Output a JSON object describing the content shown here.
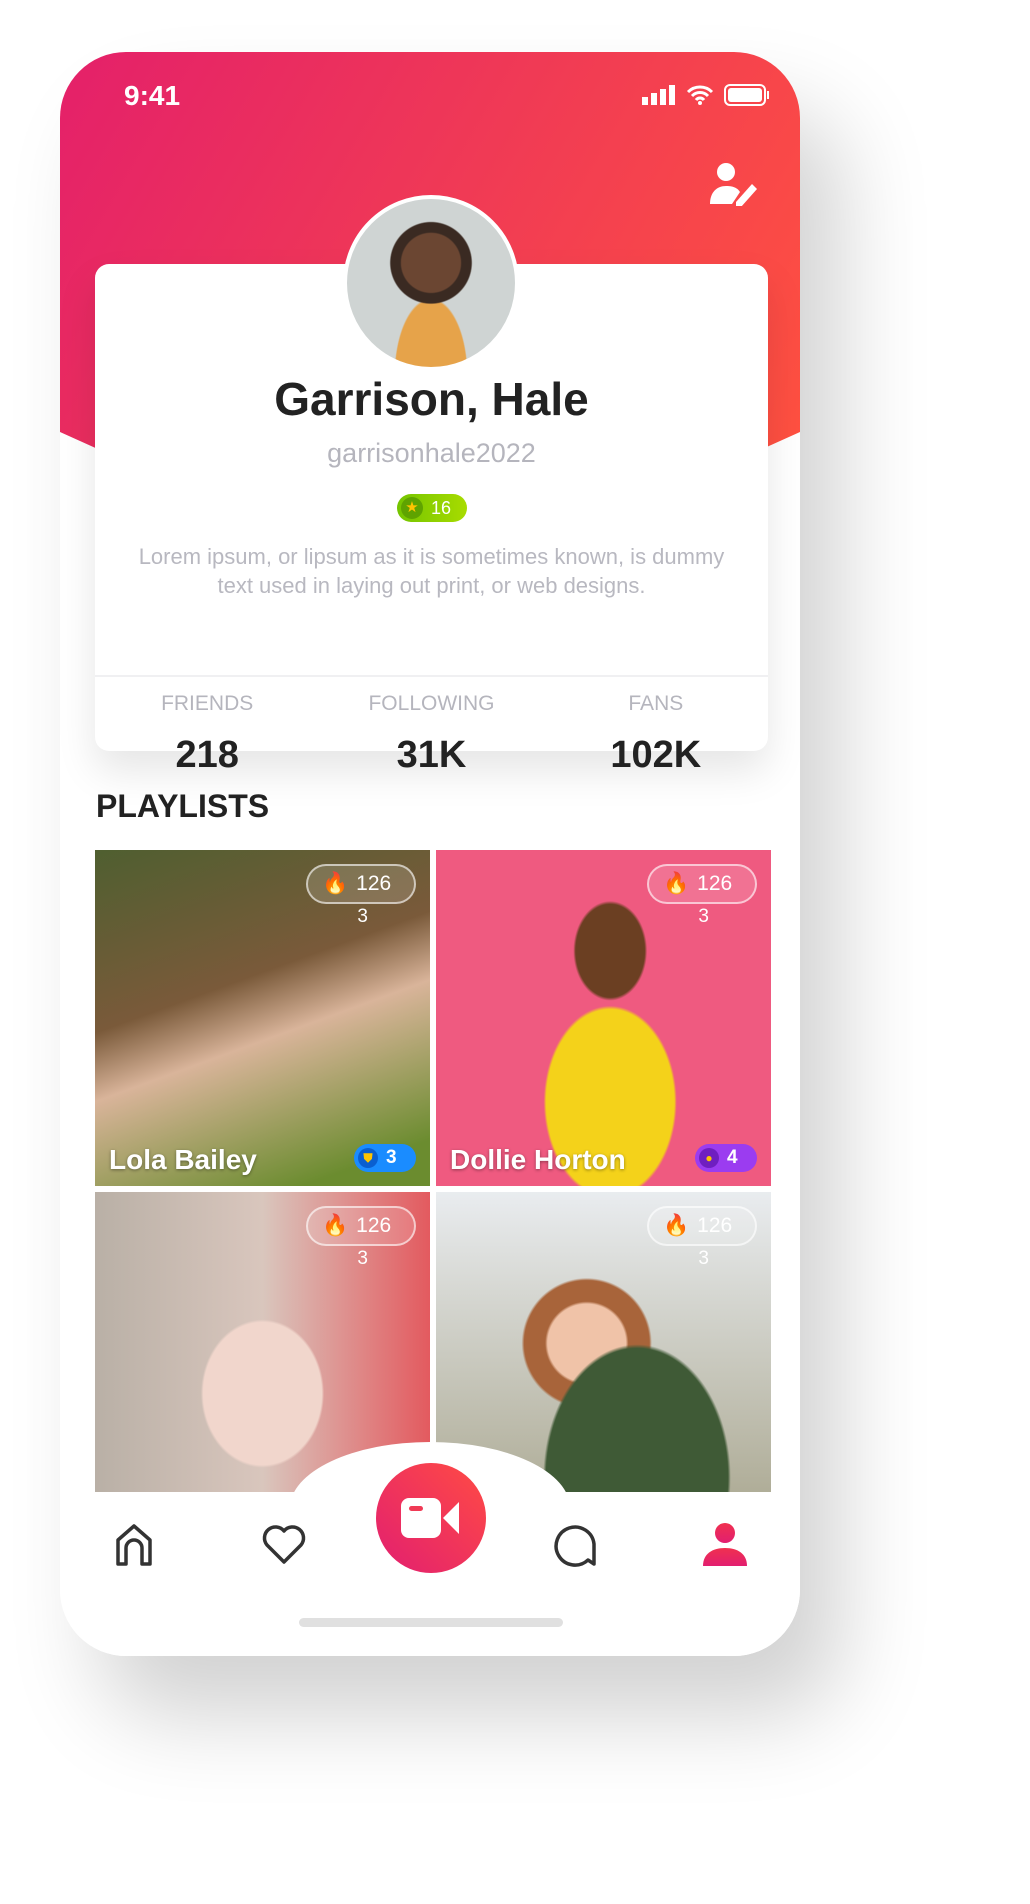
{
  "status_bar": {
    "time": "9:41"
  },
  "profile": {
    "name": "Garrison, Hale",
    "username": "garrisonhale2022",
    "level": "16",
    "bio": "Lorem ipsum, or lipsum as it is sometimes known, is dummy text used in laying out print, or web designs."
  },
  "stats": [
    {
      "label": "FRIENDS",
      "value": "218"
    },
    {
      "label": "FOLLOWING",
      "value": "31K"
    },
    {
      "label": "FANS",
      "value": "102K"
    }
  ],
  "playlists": {
    "title": "PLAYLISTS",
    "items": [
      {
        "name": "Lola Bailey",
        "fire": "126",
        "sub": "3",
        "badge": "3",
        "badge_color": "#1a8cff"
      },
      {
        "name": "Dollie Horton",
        "fire": "126",
        "sub": "3",
        "badge": "4",
        "badge_color": "#9b3cf0"
      },
      {
        "name": "",
        "fire": "126",
        "sub": "3"
      },
      {
        "name": "",
        "fire": "126",
        "sub": "3"
      }
    ]
  },
  "nav": {
    "items": [
      "home-icon",
      "heart-icon",
      "video-camera-icon",
      "chat-icon",
      "profile-icon"
    ],
    "active": "profile-icon"
  },
  "colors": {
    "accent": "#f03a55",
    "gradient_start": "#e4206a",
    "gradient_end": "#ff5140"
  }
}
